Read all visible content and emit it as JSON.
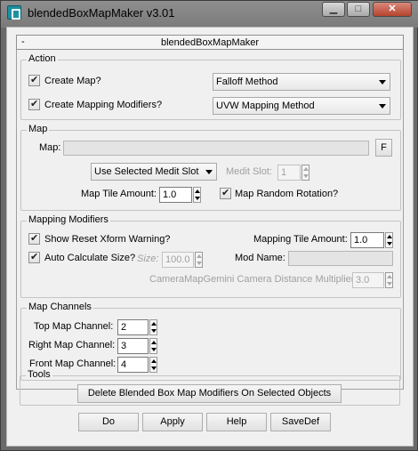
{
  "window": {
    "title": "blendedBoxMapMaker v3.01",
    "controls": {
      "minimize": "▁",
      "maximize": "□",
      "close": "✕"
    }
  },
  "rollout": {
    "collapse": "-",
    "title": "blendedBoxMapMaker"
  },
  "action": {
    "label": "Action",
    "create_map": {
      "label": "Create Map?",
      "checked": true,
      "dropdown": "Falloff Method"
    },
    "create_modifiers": {
      "label": "Create Mapping Modifiers?",
      "checked": true,
      "dropdown": "UVW Mapping Method"
    }
  },
  "map": {
    "label": "Map",
    "map_label": "Map:",
    "map_value": "",
    "f_button": "F",
    "medit_dropdown": "Use Selected Medit Slot",
    "medit_slot_label": "Medit Slot:",
    "medit_slot_value": "1",
    "tile_label": "Map Tile Amount:",
    "tile_value": "1.0",
    "random_rotation": {
      "label": "Map Random Rotation?",
      "checked": true
    }
  },
  "mapping": {
    "label": "Mapping Modifiers",
    "reset_warning": {
      "label": "Show Reset Xform Warning?",
      "checked": true
    },
    "tile_label": "Mapping Tile Amount:",
    "tile_value": "1.0",
    "auto_size": {
      "label": "Auto Calculate Size?",
      "checked": true
    },
    "size_label": "Size:",
    "size_value": "100.0",
    "mod_name_label": "Mod Name:",
    "mod_name_value": "",
    "gemini_label": "CameraMapGemini Camera Distance Multiplier:",
    "gemini_value": "3.0"
  },
  "channels": {
    "label": "Map Channels",
    "top": {
      "label": "Top Map Channel:",
      "value": "2"
    },
    "right": {
      "label": "Right Map Channel:",
      "value": "3"
    },
    "front": {
      "label": "Front Map Channel:",
      "value": "4"
    }
  },
  "tools": {
    "label": "Tools",
    "delete_button": "Delete Blended Box Map Modifiers On Selected Objects"
  },
  "footer": {
    "do": "Do",
    "apply": "Apply",
    "help": "Help",
    "savedef": "SaveDef"
  }
}
